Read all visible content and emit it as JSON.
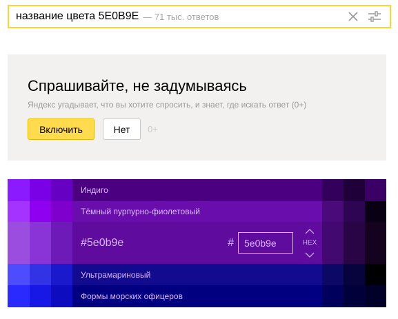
{
  "search": {
    "query": "название цвета 5E0B9E",
    "meta": "— 71 тыс. ответов",
    "clear_icon": "close-icon",
    "filter_icon": "settings-sliders-icon"
  },
  "promo": {
    "title": "Спрашивайте, не задумываясь",
    "description": "Яндекс угадывает, что вы хотите спросить, и знает, где искать ответ (0+)",
    "enable_label": "Включить",
    "no_label": "Нет",
    "age": "0+"
  },
  "colors": {
    "rows": [
      {
        "label": "Индиго"
      },
      {
        "label": "Тёмный пурпурно-фиолетовый"
      },
      {
        "label": "#5e0b9e",
        "hash": "#",
        "hex_value": "5e0b9e",
        "format": "HEX"
      },
      {
        "label": "Ультрамариновый"
      },
      {
        "label": "Формы морских офицеров"
      }
    ],
    "accent": "#5e0b9e",
    "search_border": "#ffd331",
    "button_yellow": "#ffdb4d"
  }
}
